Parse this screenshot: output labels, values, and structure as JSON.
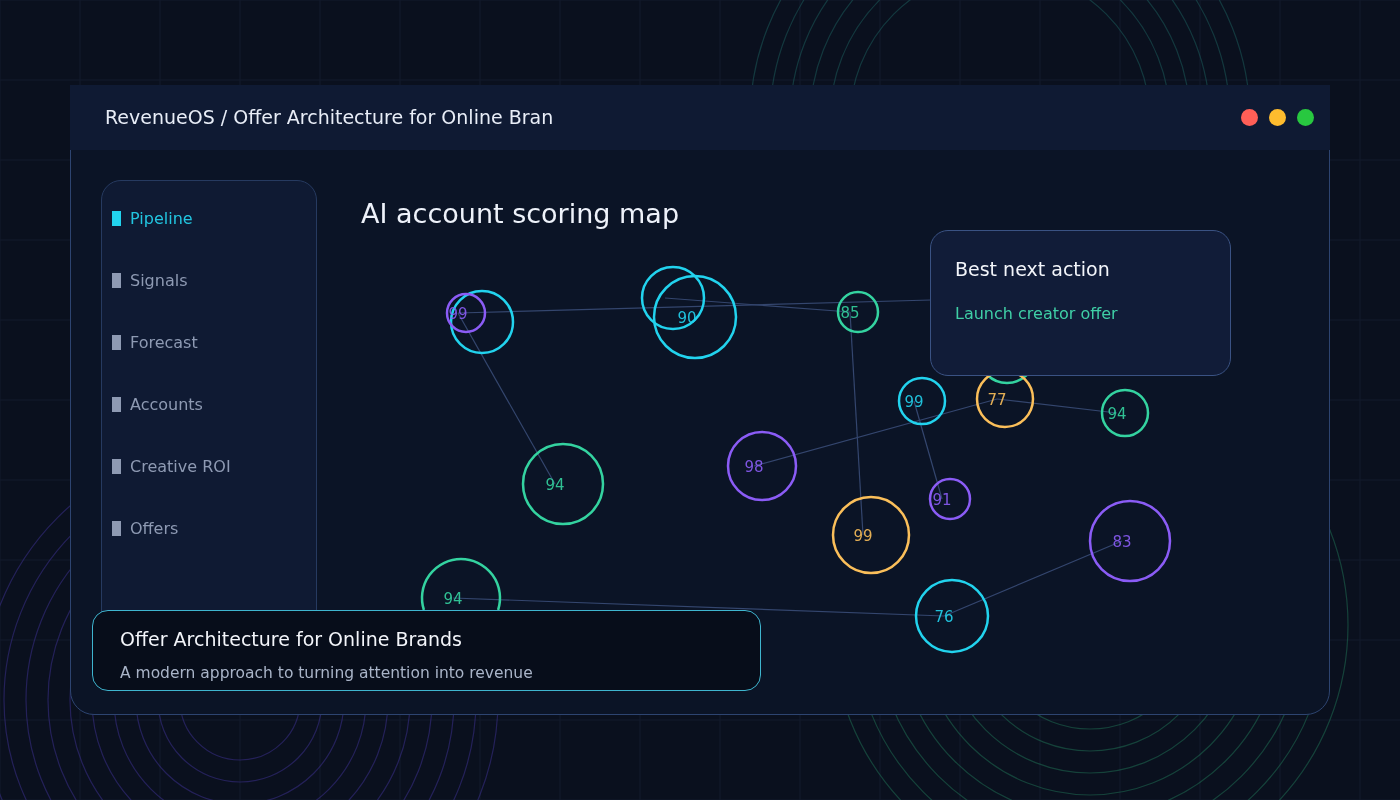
{
  "window": {
    "title": "RevenueOS / Offer Architecture for Online Bran"
  },
  "sidebar": {
    "items": [
      {
        "label": "Pipeline",
        "selected": true
      },
      {
        "label": "Signals",
        "selected": false
      },
      {
        "label": "Forecast",
        "selected": false
      },
      {
        "label": "Accounts",
        "selected": false
      },
      {
        "label": "Creative ROI",
        "selected": false
      },
      {
        "label": "Offers",
        "selected": false
      }
    ]
  },
  "map": {
    "title": "AI account scoring map",
    "nodes": [
      {
        "color": "#22d3ee"
      },
      {
        "score": "99",
        "color": "#8b5cf6"
      },
      {
        "color": "#22d3ee"
      },
      {
        "score": "90",
        "color": "#22d3ee"
      },
      {
        "score": "85",
        "color": "#34d3a0"
      },
      {
        "color": "#34d3a0"
      },
      {
        "score": "99",
        "color": "#22d3ee"
      },
      {
        "score": "77",
        "color": "#fbbf5a"
      },
      {
        "score": "94",
        "color": "#34d3a0"
      },
      {
        "score": "98",
        "color": "#8b5cf6"
      },
      {
        "score": "94",
        "color": "#34d3a0"
      },
      {
        "score": "91",
        "color": "#8b5cf6"
      },
      {
        "score": "99",
        "color": "#fbbf5a"
      },
      {
        "score": "83",
        "color": "#8b5cf6"
      },
      {
        "score": "94",
        "color": "#34d3a0"
      },
      {
        "score": "76",
        "color": "#22d3ee"
      }
    ],
    "kind": "network"
  },
  "action_card": {
    "title": "Best next action",
    "action": "Launch creator offer"
  },
  "caption": {
    "title": "Offer Architecture for Online Brands",
    "subtitle": "A modern approach to turning attention into revenue"
  }
}
